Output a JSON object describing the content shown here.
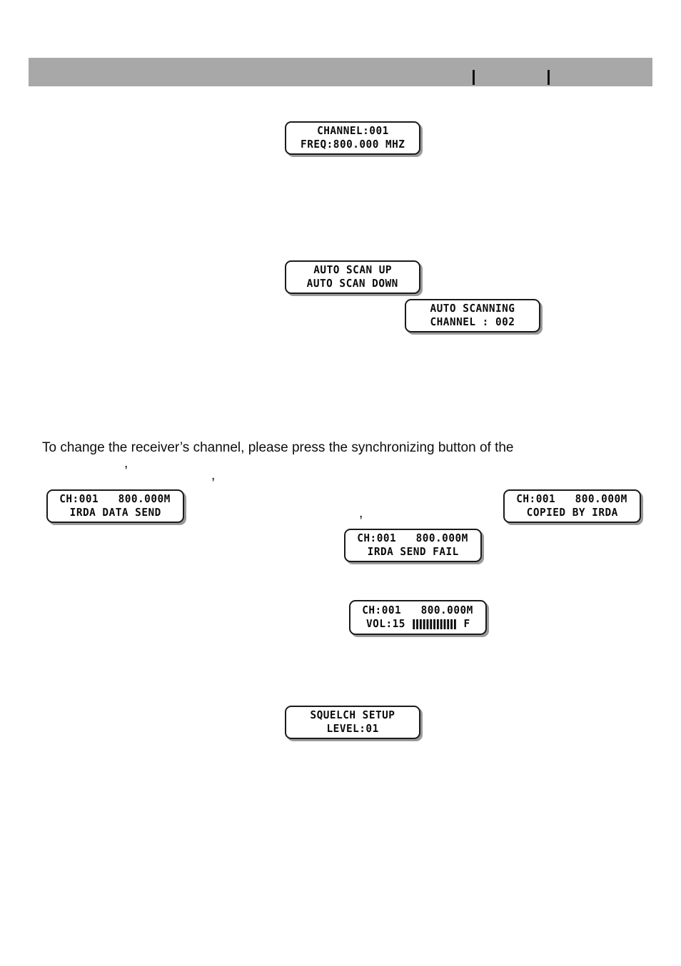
{
  "page": {
    "background_color": "#ffffff",
    "header": {
      "bar_color": "#a8a8a8",
      "tick_color": "#101010",
      "tick_count": 2
    }
  },
  "body_text": {
    "paragraph": "To change the receiver’s channel, please press the synchronizing button of the",
    "stray_marks": [
      ",",
      ",",
      ","
    ]
  },
  "displays": [
    {
      "id": "channel-freq",
      "name": "channel-frequency-display",
      "line1": "CHANNEL:001",
      "line2": "FREQ:800.000 MHZ"
    },
    {
      "id": "auto-scan",
      "name": "auto-scan-menu-display",
      "line1": "AUTO SCAN UP",
      "line2": "AUTO SCAN DOWN"
    },
    {
      "id": "auto-scanning",
      "name": "auto-scanning-progress-display",
      "line1": "AUTO SCANNING",
      "line2": "CHANNEL : 002"
    },
    {
      "id": "irda-send",
      "name": "irda-data-send-display",
      "line1": "CH:001   800.000M",
      "line2": "IRDA DATA SEND"
    },
    {
      "id": "irda-copied",
      "name": "irda-copied-display",
      "line1": "CH:001   800.000M",
      "line2": "COPIED BY IRDA"
    },
    {
      "id": "irda-fail",
      "name": "irda-send-fail-display",
      "line1": "CH:001   800.000M",
      "line2": "IRDA SEND FAIL"
    },
    {
      "id": "volume",
      "name": "volume-level-display",
      "line1": "CH:001   800.000M",
      "line2_label": "VOL:15",
      "line2_suffix": "F",
      "bar_segments": 13
    },
    {
      "id": "squelch",
      "name": "squelch-setup-display",
      "line1": "SQUELCH SETUP",
      "line2": "LEVEL:01"
    }
  ]
}
